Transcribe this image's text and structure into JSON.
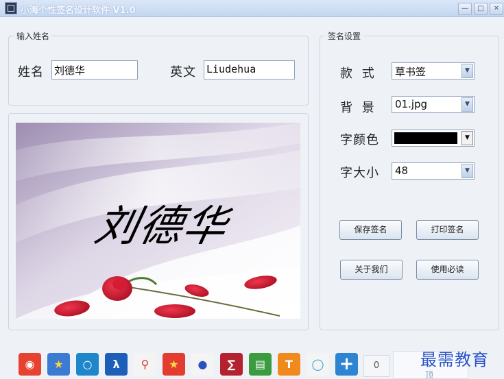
{
  "window": {
    "title": "小海个性签名设计软件 V1.0"
  },
  "name_group": {
    "legend": "输入姓名",
    "name_label": "姓名",
    "name_value": "刘德华",
    "english_label": "英文",
    "english_value": "Liudehua"
  },
  "settings_group": {
    "legend": "签名设置",
    "style_label": "款  式",
    "style_value": "草书签",
    "background_label": "背  景",
    "background_value": "01.jpg",
    "color_label": "字颜色",
    "color_value": "#000000",
    "size_label": "字大小",
    "size_value": "48"
  },
  "buttons": {
    "save": "保存签名",
    "print": "打印签名",
    "about": "关于我们",
    "help": "使用必读"
  },
  "preview": {
    "signature_text": "刘德华"
  },
  "toolbar": {
    "counter": "0",
    "top_label": "顶",
    "icons": [
      "weibo-icon",
      "star-icon",
      "pengyou-icon",
      "renren-icon",
      "tencent-weibo-icon",
      "qq-space-icon",
      "baidu-icon",
      "kaixin-icon",
      "douban-icon",
      "t-icon",
      "qzone-icon",
      "more-plus-icon"
    ]
  },
  "watermark": "最需教育",
  "colors": {
    "accent": "#2a52c9",
    "window_bg": "#eef2f7",
    "titlebar": "#c3d6ef"
  }
}
